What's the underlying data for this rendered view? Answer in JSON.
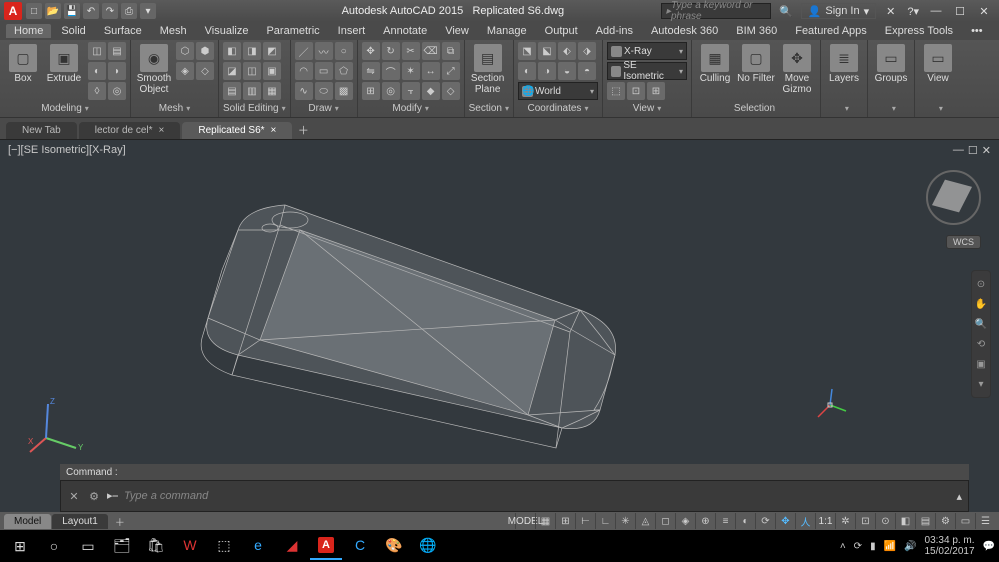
{
  "app": {
    "title_left": "Autodesk AutoCAD 2015",
    "title_right": "Replicated S6.dwg",
    "search_placeholder": "Type a keyword or phrase",
    "sign_in": "Sign In"
  },
  "qat_icons": [
    "new",
    "open",
    "save",
    "undo",
    "redo",
    "plot",
    "dropdown"
  ],
  "menus": [
    "Home",
    "Solid",
    "Surface",
    "Mesh",
    "Visualize",
    "Parametric",
    "Insert",
    "Annotate",
    "View",
    "Manage",
    "Output",
    "Add-ins",
    "Autodesk 360",
    "BIM 360",
    "Featured Apps",
    "Express Tools",
    "•••"
  ],
  "menu_active": "Home",
  "ribbon": {
    "modeling": {
      "label": "Modeling",
      "items": [
        {
          "label": "Box",
          "icon": "□"
        },
        {
          "label": "Extrude",
          "icon": "▣"
        }
      ]
    },
    "mesh": {
      "label": "Mesh",
      "item": {
        "label": "Smooth\nObject",
        "icon": "◉"
      }
    },
    "solid_editing": {
      "label": "Solid Editing"
    },
    "draw": {
      "label": "Draw"
    },
    "modify": {
      "label": "Modify"
    },
    "section": {
      "label": "Section",
      "item": {
        "label": "Section\nPlane",
        "icon": "▤"
      }
    },
    "coordinates": {
      "label": "Coordinates",
      "world": "World"
    },
    "view_panel": {
      "label": "View",
      "visual": "X-Ray",
      "viewdir": "SE Isometric"
    },
    "selection": {
      "label": "Selection",
      "items": [
        {
          "label": "Culling",
          "icon": "▦"
        },
        {
          "label": "No Filter",
          "icon": "▢"
        },
        {
          "label": "Move\nGizmo",
          "icon": "✥"
        }
      ]
    },
    "layers": {
      "label": "",
      "item": {
        "label": "Layers",
        "icon": "≣"
      }
    },
    "groups": {
      "label": "",
      "item": {
        "label": "Groups",
        "icon": "▭"
      }
    },
    "view_end": {
      "label": "",
      "item": {
        "label": "View",
        "icon": "▭"
      }
    }
  },
  "doctabs": [
    "New Tab",
    "lector de cel*",
    "Replicated S6*"
  ],
  "doctab_active": 2,
  "viewport": {
    "label": "[−][SE Isometric][X-Ray]",
    "wcs": "WCS"
  },
  "ucs_axes": {
    "x": "X",
    "y": "Y",
    "z": "Z"
  },
  "command": {
    "history": "Command :",
    "placeholder": "Type a command"
  },
  "spacetabs": [
    "Model",
    "Layout1"
  ],
  "spacetab_active": 0,
  "status_items": [
    "MODEL",
    "grid",
    "snap",
    "ortho",
    "polar",
    "osnap",
    "otrack",
    "dyn",
    "lwt",
    "qp",
    "sel",
    "anno",
    "1:1",
    "gear",
    "iso",
    "hw",
    "clean",
    "cust"
  ],
  "status_model": "MODEL",
  "status_scale": "1:1",
  "clock": {
    "time": "03:34 p. m.",
    "date": "15/02/2017"
  },
  "taskbar_apps": [
    "win",
    "cortana",
    "taskview",
    "explorer",
    "store",
    "wps",
    "dropbox",
    "edge",
    "autocad",
    "cura",
    "paint",
    "chrome"
  ]
}
